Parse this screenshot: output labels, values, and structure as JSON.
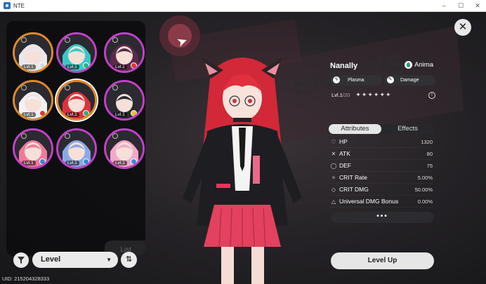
{
  "window": {
    "title": "NTE",
    "minimize": "–",
    "maximize": "☐",
    "close": "✕"
  },
  "uid": "UID: 215204328333",
  "roster": {
    "list_label": "List",
    "items": [
      {
        "level": "Lvl.1",
        "frame": "orange",
        "element_color": "#d8d8d8",
        "hair": "#e8e8ee"
      },
      {
        "level": "Lvl.1",
        "frame": "purple",
        "element_color": "#2fb07c",
        "hair": "#39c8c8"
      },
      {
        "level": "Lvl.1",
        "frame": "purple",
        "element_color": "#d83a3a",
        "hair": "#5a2a48"
      },
      {
        "level": "Lvl.1",
        "frame": "orange",
        "element_color": "#d83a3a",
        "hair": "#f2f2f4"
      },
      {
        "level": "Lvl.1",
        "frame": "orange",
        "element_color": "#2fb07c",
        "hair": "#e0303e"
      },
      {
        "level": "Lvl.1",
        "frame": "purple",
        "element_color": "#e6c230",
        "hair": "#2a2a30"
      },
      {
        "level": "Lvl.1",
        "frame": "purple",
        "element_color": "#3a8ad8",
        "hair": "#f07a9a"
      },
      {
        "level": "Lvl.1",
        "frame": "purple",
        "element_color": "#3a8ad8",
        "hair": "#8aa8e8"
      },
      {
        "level": "Lvl.1",
        "frame": "purple",
        "element_color": "#3a8ad8",
        "hair": "#f2a8c8"
      }
    ]
  },
  "controls": {
    "filter_icon": "filter-icon",
    "sort_label": "Level",
    "sort_chevron": "▼",
    "order_icon": "⇅"
  },
  "close_glyph": "✕",
  "character": {
    "name": "Nanally",
    "faction": "Anima",
    "tags": [
      {
        "icon": "ϟ",
        "label": "Plasma"
      },
      {
        "icon": "✎",
        "label": "Damage"
      }
    ],
    "level": "Lvl.1",
    "level_max": "/20",
    "stars": "✦✦✦✦✦✦",
    "breakthrough": "!"
  },
  "tabs": {
    "attributes": "Attributes",
    "effects": "Effects"
  },
  "stats": [
    {
      "icon": "♡",
      "name": "HP",
      "value": "1320"
    },
    {
      "icon": "✕",
      "name": "ATK",
      "value": "80"
    },
    {
      "icon": "◯",
      "name": "DEF",
      "value": "75"
    },
    {
      "icon": "✧",
      "name": "CRIT Rate",
      "value": "5.00%"
    },
    {
      "icon": "◇",
      "name": "CRIT DMG",
      "value": "50.00%"
    },
    {
      "icon": "△",
      "name": "Universal DMG Bonus",
      "value": "0.00%"
    }
  ],
  "more_label": "•••",
  "level_up_label": "Level Up",
  "colors": {
    "accent_pink": "#e03a5a",
    "panel_bg": "#0c0c0e",
    "button_light": "#e6e6e6"
  }
}
